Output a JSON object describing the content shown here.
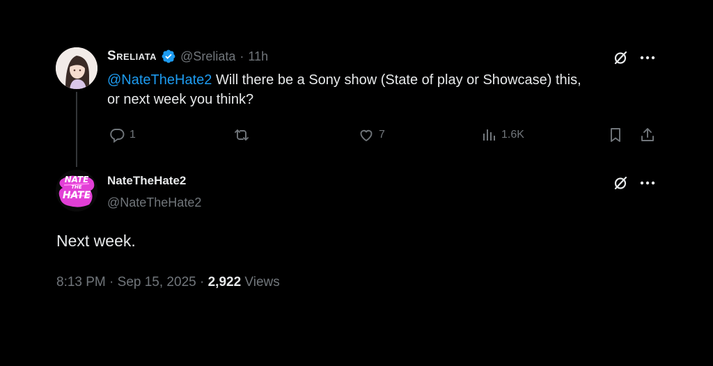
{
  "reply_tweet": {
    "display_name": "Sreliata",
    "handle": "@Sreliata",
    "separator": "·",
    "time": "11h",
    "mention": "@NateTheHate2",
    "text_line1": " Will there be a Sony show (State of play or Showcase) this,",
    "text_line2": "or next week you think?",
    "replies": "1",
    "likes": "7",
    "views": "1.6K",
    "verified": true
  },
  "main_tweet": {
    "display_name": "NateTheHate2",
    "handle": "@NateTheHate2",
    "avatar_text_top": "NATE",
    "avatar_text_mid": "THE",
    "avatar_text_bottom": "HATE",
    "text": "Next week.",
    "time": "8:13 PM",
    "sep1": "·",
    "date": "Sep 15, 2025",
    "sep2": "·",
    "views_count": "2,922",
    "views_label": "Views"
  },
  "colors": {
    "background": "#000000",
    "text": "#e7e9ea",
    "muted": "#71767b",
    "accent": "#1d9bf0",
    "avatar_nate": "#e23fd6"
  },
  "icons": [
    "verified-badge-icon",
    "grok-icon",
    "more-icon",
    "reply-icon",
    "retweet-icon",
    "like-icon",
    "views-icon",
    "bookmark-icon",
    "share-icon"
  ]
}
